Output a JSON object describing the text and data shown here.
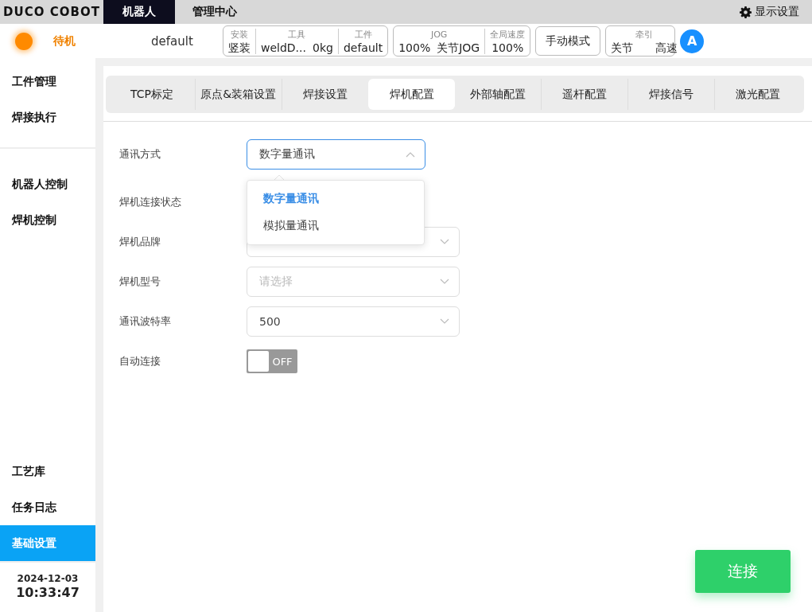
{
  "brand": "DUCO COBOT",
  "top_tabs": [
    {
      "label": "机器人",
      "selected": true
    },
    {
      "label": "管理中心",
      "selected": false
    }
  ],
  "display_settings": "显示设置",
  "status": {
    "label": "待机"
  },
  "program": "default",
  "info_groups": [
    {
      "cells": [
        {
          "label": "安装",
          "values": [
            "竖装"
          ]
        },
        {
          "label": "工具",
          "values": [
            "weldD...",
            "0kg"
          ]
        },
        {
          "label": "工件",
          "values": [
            "default"
          ]
        }
      ]
    },
    {
      "cells": [
        {
          "label": "JOG",
          "values": [
            "100%",
            "关节JOG"
          ]
        },
        {
          "label": "全局速度",
          "values": [
            "100%"
          ]
        }
      ]
    }
  ],
  "mode_button": "手动模式",
  "traction": {
    "label": "牵引",
    "values": [
      "关节",
      "高速"
    ]
  },
  "avatar": "A",
  "sidebar": {
    "groups": [
      [
        {
          "label": "工件管理",
          "selected": false
        },
        {
          "label": "焊接执行",
          "selected": false
        }
      ],
      [
        {
          "label": "机器人控制",
          "selected": false
        },
        {
          "label": "焊机控制",
          "selected": false
        }
      ],
      [
        {
          "label": "工艺库",
          "selected": false
        },
        {
          "label": "任务日志",
          "selected": false
        },
        {
          "label": "基础设置",
          "selected": true
        }
      ]
    ]
  },
  "datetime": {
    "date": "2024-12-03",
    "time": "10:33:47"
  },
  "tabs": [
    {
      "label": "TCP标定",
      "selected": false
    },
    {
      "label": "原点&装箱设置",
      "selected": false
    },
    {
      "label": "焊接设置",
      "selected": false
    },
    {
      "label": "焊机配置",
      "selected": true
    },
    {
      "label": "外部轴配置",
      "selected": false
    },
    {
      "label": "遥杆配置",
      "selected": false
    },
    {
      "label": "焊接信号",
      "selected": false
    },
    {
      "label": "激光配置",
      "selected": false
    }
  ],
  "form": [
    {
      "label": "通讯方式",
      "kind": "select",
      "value": "数字量通讯",
      "open": true
    },
    {
      "label": "焊机连接状态",
      "kind": "status"
    },
    {
      "label": "焊机品牌",
      "kind": "select",
      "open": false
    },
    {
      "label": "焊机型号",
      "kind": "select",
      "placeholder": "请选择",
      "open": false
    },
    {
      "label": "通讯波特率",
      "kind": "select",
      "value": "500",
      "open": false
    },
    {
      "label": "自动连接",
      "kind": "toggle",
      "on": false,
      "state_label": "OFF"
    }
  ],
  "dropdown": {
    "options": [
      {
        "label": "数字量通讯",
        "selected": true
      },
      {
        "label": "模拟量通讯",
        "selected": false
      }
    ]
  },
  "connect_button": "连接"
}
